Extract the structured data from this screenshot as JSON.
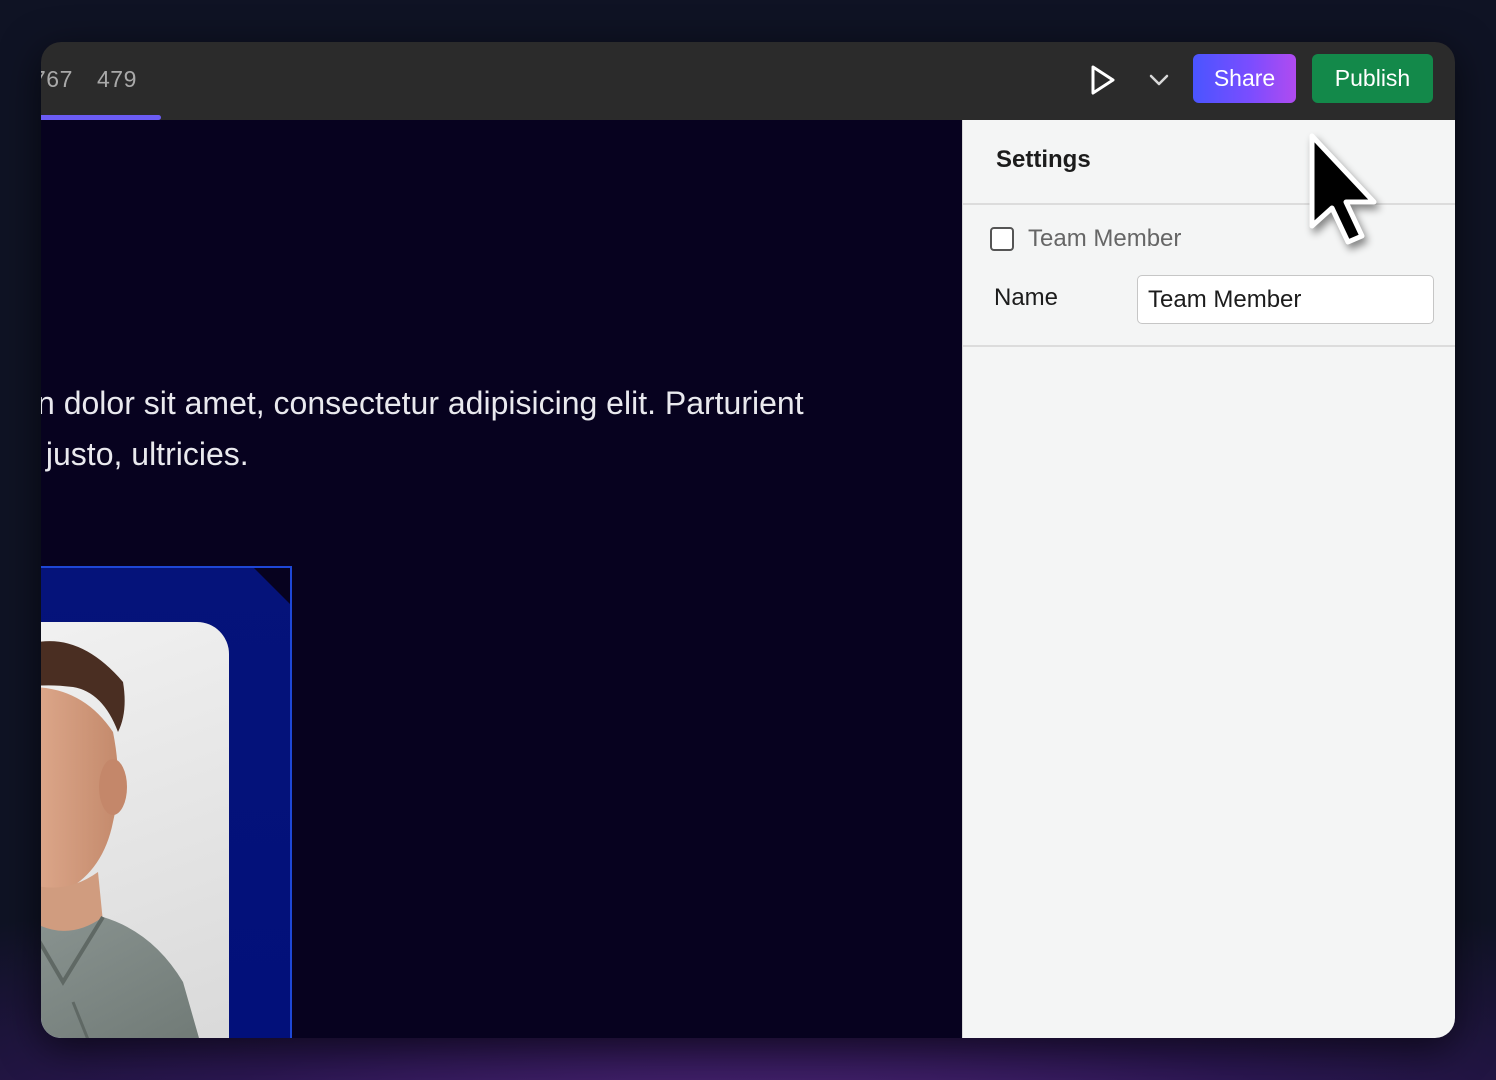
{
  "topbar": {
    "breakpoints": [
      "767",
      "479"
    ],
    "share_label": "Share",
    "publish_label": "Publish",
    "play_icon": "play-icon",
    "chevron_icon": "chevron-down-icon"
  },
  "canvas": {
    "paragraph": "n dolor sit amet, consectetur adipisicing elit. Parturient\n justo, ultricies."
  },
  "settings": {
    "title": "Settings",
    "checkbox_label": "Team Member",
    "checkbox_checked": false,
    "name_label": "Name",
    "name_value": "Team Member"
  },
  "colors": {
    "publish": "#13894a",
    "share_gradient_start": "#4a55ff",
    "share_gradient_end": "#b04bf0",
    "tab_indicator": "#6b5cf5",
    "canvas_bg": "#07021f"
  }
}
